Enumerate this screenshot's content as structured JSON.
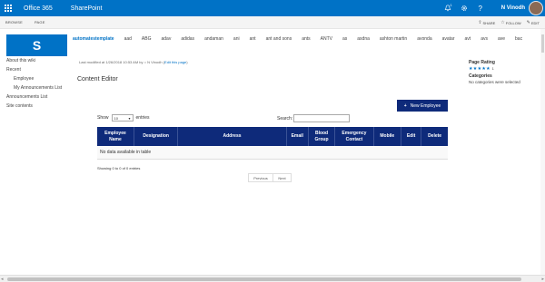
{
  "suitebar": {
    "brand": "Office 365",
    "site_name": "SharePoint",
    "notification_count": "1",
    "user_name": "N Vinodh",
    "bg_color": "#0072c6",
    "icons": [
      "waffle-icon",
      "bell-icon",
      "gear-icon",
      "help-icon"
    ]
  },
  "ribbon": {
    "tabs": [
      "BROWSE",
      "PAGE"
    ],
    "share": "SHARE",
    "follow": "FOLLOW",
    "edit": "EDIT"
  },
  "top_nav": {
    "items": [
      "automatestemplate",
      "aad",
      "ABG",
      "adav",
      "adidas",
      "andaman",
      "ani",
      "ant",
      "ant and sons",
      "ants",
      "ANTV",
      "as",
      "asdna",
      "ashton martin",
      "avonda",
      "avatar",
      "avt",
      "avs",
      "ave",
      "bac"
    ]
  },
  "left_nav": {
    "items": [
      {
        "label": "About this wiki",
        "sub": false
      },
      {
        "label": "Recent",
        "sub": false
      },
      {
        "label": "Employee",
        "sub": true
      },
      {
        "label": "My Announcements List",
        "sub": true
      },
      {
        "label": "Announcements List",
        "sub": false
      },
      {
        "label": "Site contents",
        "sub": false
      }
    ]
  },
  "page": {
    "modified_text": "Last modified at 1/26/2018 10:53 AM by",
    "modified_user": "N Vinodh",
    "edit_link": "Edit this page",
    "title": "Content Editor"
  },
  "toolbar": {
    "new_employee_label": "New Employee",
    "show_label": "Show",
    "show_value": "10",
    "entries_label": "entries",
    "search_label": "Search:",
    "search_value": ""
  },
  "table": {
    "headers": [
      "Employee Name",
      "Designation",
      "Address",
      "Email",
      "Blood Group",
      "Emergency Contact",
      "Mobile",
      "Edit",
      "Delete"
    ],
    "empty_message": "No data available in table",
    "header_color": "#0e2a7a"
  },
  "footer": {
    "info": "Showing 0 to 0 of 0 entries",
    "previous": "Previous",
    "next": "Next"
  },
  "right_panel": {
    "rating_heading": "Page Rating",
    "rating_stars": "★★★★★",
    "rating_count": "1",
    "categories_heading": "Categories",
    "categories_text": "No categories were selected"
  }
}
